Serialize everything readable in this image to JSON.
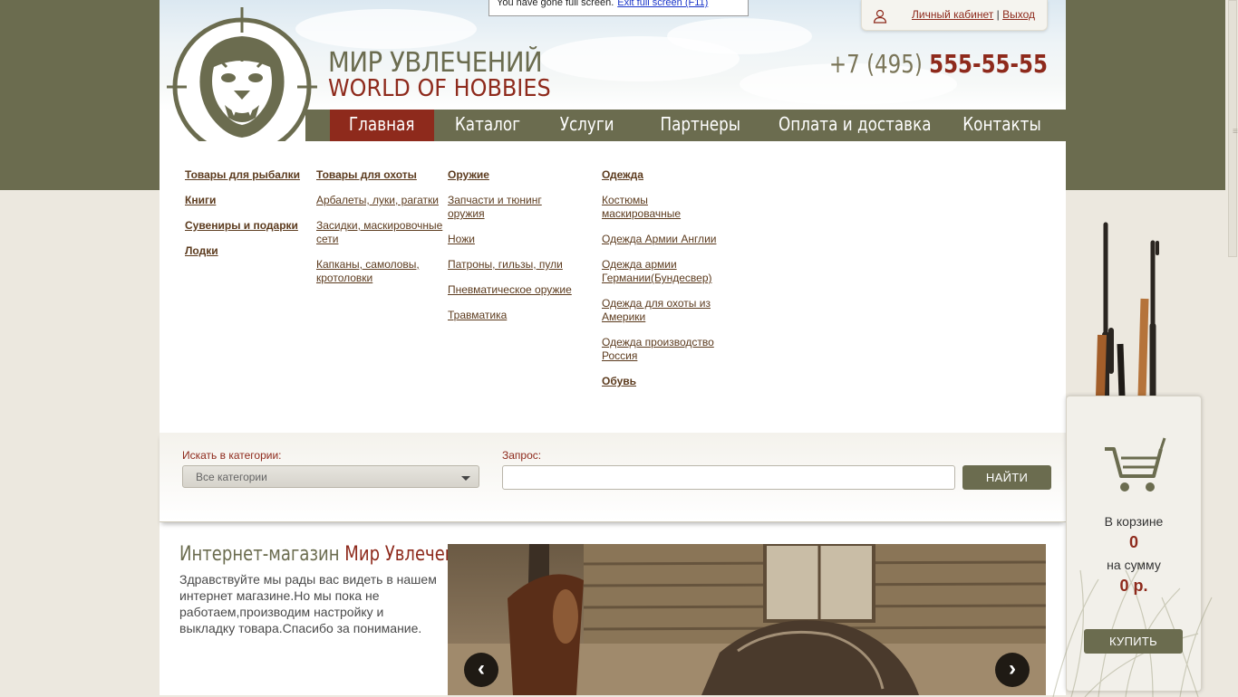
{
  "fullscreen_banner": {
    "message": "You have gone full screen.",
    "exit_link": "Exit full screen (F11)"
  },
  "header": {
    "brand_ru": "МИР УВЛЕЧЕНИЙ",
    "brand_en": "WORLD OF HOBBIES",
    "phone_prefix": "+7 (495)",
    "phone_number": "555-55-55",
    "cabinet_link": "Личный кабинет",
    "separator": "|",
    "logout_link": "Выход"
  },
  "nav": {
    "items": [
      {
        "label": "Главная",
        "active": true
      },
      {
        "label": "Каталог"
      },
      {
        "label": "Услуги"
      },
      {
        "label": "Партнеры"
      },
      {
        "label": "Оплата и доставка"
      },
      {
        "label": "Контакты"
      }
    ]
  },
  "menu": {
    "col1": [
      "Товары для рыбалки",
      "Книги",
      "Сувениры и подарки",
      "Лодки"
    ],
    "col2": [
      "Товары для охоты",
      "Арбалеты, луки, рагатки",
      "Засидки, маскировочные сети",
      "Капканы, самоловы, кротоловки"
    ],
    "col3": [
      "Оружие",
      "Запчасти и тюнинг оружия",
      "Ножи",
      "Патроны, гильзы, пули",
      "Пневматическое оружие",
      "Травматика"
    ],
    "col4": [
      "Одежда",
      "Костюмы маскировачные",
      "Одежда Армии Англии",
      "Одежда армии Германии(Бундесвер)",
      "Одежда для охоты из Америки",
      "Одежда производство Россия",
      "Обувь"
    ]
  },
  "search": {
    "category_label": "Искать в категории:",
    "category_value": "Все категории",
    "query_label": "Запрос:",
    "query_value": "",
    "button": "НАЙТИ"
  },
  "intro": {
    "title_part1": "Интернет-магазин",
    "title_part2": "Мир Увлечений",
    "text": "Здравствуйте мы рады вас видеть в нашем интернет магазине.Но мы пока не работаем,производим настройку и выкладку товара.Спасибо за понимание."
  },
  "slider": {
    "prev": "‹",
    "next": "›"
  },
  "cart": {
    "in_cart_label": "В корзине",
    "count": "0",
    "sum_label": "на сумму",
    "sum": "0 р.",
    "buy_button": "КУПИТЬ"
  },
  "colors": {
    "olive": "#6b6c4f",
    "maroon": "#8e2a1c",
    "link_brown": "#5c3b1e",
    "beige": "#ece8df"
  }
}
